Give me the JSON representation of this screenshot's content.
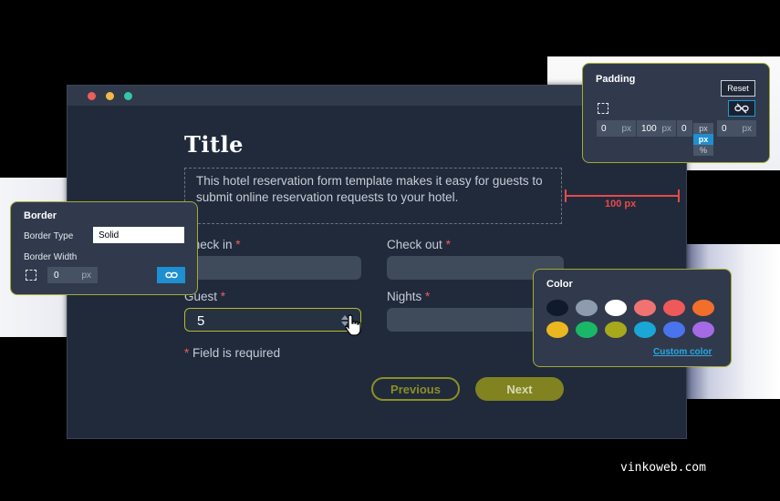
{
  "form": {
    "title": "Title",
    "description": "This hotel reservation form template makes it easy for guests to submit online reservation requests to your hotel.",
    "fields": {
      "check_in": {
        "label": "Check in",
        "required_mark": "*"
      },
      "check_out": {
        "label": "Check out",
        "required_mark": "*"
      },
      "guest": {
        "label": "Guest",
        "required_mark": "*",
        "value": "5"
      },
      "nights": {
        "label": "Nights",
        "required_mark": "*"
      }
    },
    "required_note": {
      "mark": "*",
      "text": "Field is required"
    },
    "buttons": {
      "previous": "Previous",
      "next": "Next"
    }
  },
  "measurement": {
    "label": "100 px"
  },
  "padding_panel": {
    "title": "Padding",
    "reset_label": "Reset",
    "values": [
      {
        "value": "0",
        "unit": "px"
      },
      {
        "value": "100",
        "unit": "px"
      },
      {
        "value": "0",
        "unit": "px"
      },
      {
        "value": "0",
        "unit": "px"
      }
    ],
    "unit_options": [
      "px",
      "px",
      "%"
    ],
    "selected_unit": "px"
  },
  "border_panel": {
    "title": "Border",
    "border_type_label": "Border Type",
    "border_type_value": "Solid",
    "border_width_label": "Border Width",
    "border_width_value": "0",
    "border_width_unit": "px"
  },
  "color_panel": {
    "title": "Color",
    "swatches": [
      "#0f1a2b",
      "#8e9aad",
      "#ffffff",
      "#f07272",
      "#ef5959",
      "#f26e2b",
      "#eab720",
      "#19b866",
      "#a8a81c",
      "#1aa7d6",
      "#4a74ee",
      "#a56ae6"
    ],
    "custom_color_label": "Custom color"
  },
  "watermark": "vinkoweb.com",
  "colors": {
    "accent_olive": "#a6a933",
    "required_red": "#ef5b5b",
    "link_blue": "#1e8fd0",
    "window_bg": "#202a3b"
  }
}
